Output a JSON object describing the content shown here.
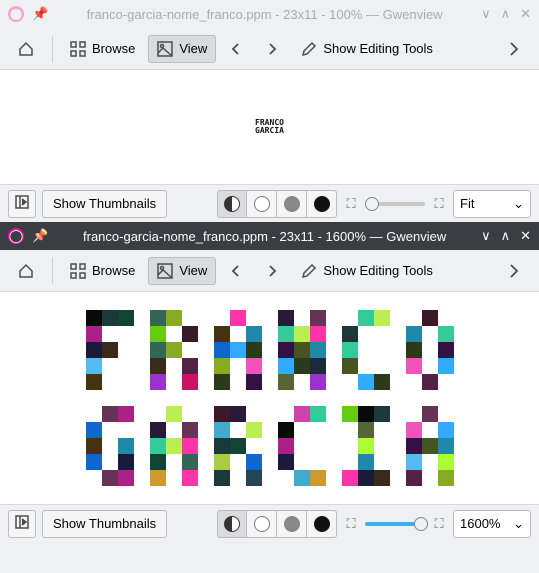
{
  "colors": {
    "accent": "#3daee9",
    "text_dark": "#232627"
  },
  "win1": {
    "title": "franco-garcia-nome_franco.ppm - 23x11 - 100% — Gwenview",
    "toolbar": {
      "browse": "Browse",
      "view": "View",
      "editing": "Show Editing Tools"
    },
    "canvas_text_line1": "FRANCO",
    "canvas_text_line2": "GARCIA",
    "botbar": {
      "thumbnails": "Show Thumbnails",
      "zoom_label": "Fit"
    }
  },
  "win2": {
    "title": "franco-garcia-nome_franco.ppm - 23x11 - 1600% — Gwenview",
    "toolbar": {
      "browse": "Browse",
      "view": "View",
      "editing": "Show Editing Tools"
    },
    "botbar": {
      "thumbnails": "Show Thumbnails",
      "zoom_label": "1600%"
    }
  }
}
